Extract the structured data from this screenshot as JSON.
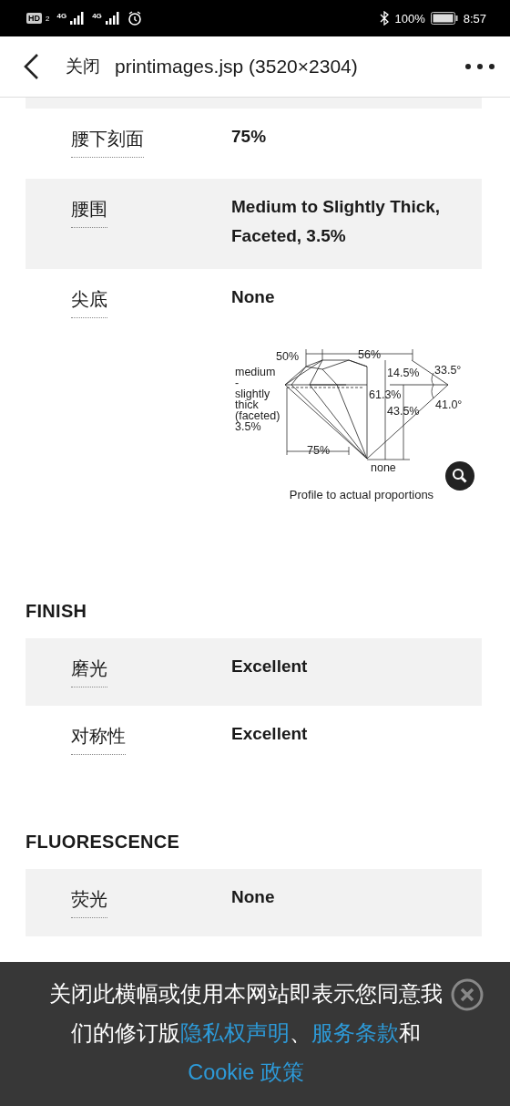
{
  "status_bar": {
    "hd": "HD",
    "sim": "2",
    "networks": [
      "4G",
      "4G"
    ],
    "battery": "100%",
    "time": "8:57"
  },
  "nav": {
    "close": "关闭",
    "title": "printimages.jsp (3520×2304)"
  },
  "sections": [
    {
      "cut_row": true,
      "rows": [
        {
          "label": "腰下刻面",
          "value": "75%",
          "shaded": false
        },
        {
          "label": "腰围",
          "value": "Medium to Slightly Thick, Faceted, 3.5%",
          "shaded": true
        },
        {
          "label": "尖底",
          "value": "None",
          "shaded": false
        }
      ],
      "diagram": {
        "labels": [
          "50%",
          "56%",
          "medium",
          "-",
          "slightly",
          "thick",
          "(faceted)",
          "3.5%",
          "14.5%",
          "33.5°",
          "61.3%",
          "43.5%",
          "41.0°",
          "75%",
          "none"
        ],
        "caption": "Profile to actual proportions"
      }
    },
    {
      "heading": "FINISH",
      "rows": [
        {
          "label": "磨光",
          "value": "Excellent",
          "shaded": true
        },
        {
          "label": "对称性",
          "value": "Excellent",
          "shaded": false
        }
      ]
    },
    {
      "heading": "FLUORESCENCE",
      "rows": [
        {
          "label": "荧光",
          "value": "None",
          "shaded": true
        }
      ]
    }
  ],
  "banner": {
    "parts": [
      {
        "kind": "text",
        "text": "关闭此横幅或使用本网站即表示您同意我们的修订版"
      },
      {
        "kind": "link",
        "text": "隐私权声明"
      },
      {
        "kind": "text",
        "text": "、"
      },
      {
        "kind": "link",
        "text": "服务条款"
      },
      {
        "kind": "text",
        "text": "和 "
      },
      {
        "kind": "link",
        "text": "Cookie 政策"
      }
    ]
  }
}
